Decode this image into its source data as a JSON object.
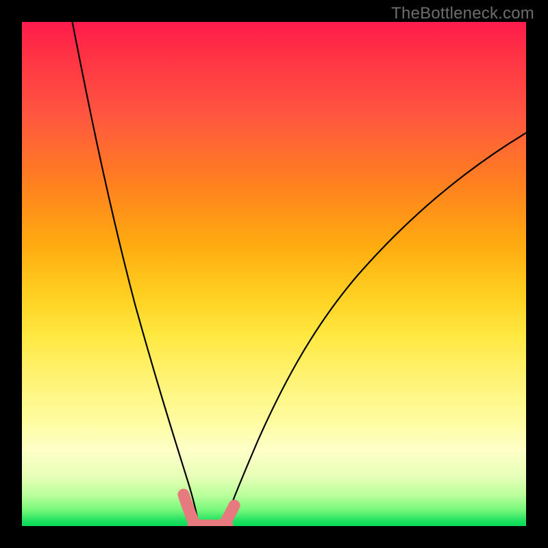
{
  "attribution": "TheBottleneck.com",
  "chart_data": {
    "type": "line",
    "title": "",
    "xlabel": "",
    "ylabel": "",
    "xlim": [
      0,
      100
    ],
    "ylim": [
      0,
      100
    ],
    "legend": false,
    "grid": false,
    "series": [
      {
        "name": "left-branch",
        "x": [
          10,
          14,
          18,
          22,
          25,
          28,
          30,
          32,
          33.5,
          35
        ],
        "y": [
          100,
          80,
          60,
          42,
          29,
          18,
          11,
          6,
          2.5,
          0
        ]
      },
      {
        "name": "floor",
        "x": [
          35,
          40
        ],
        "y": [
          0,
          0
        ]
      },
      {
        "name": "right-branch",
        "x": [
          40,
          42,
          45,
          50,
          57,
          65,
          74,
          84,
          95,
          100
        ],
        "y": [
          0,
          3,
          9,
          19,
          32,
          45,
          56,
          66,
          74,
          78
        ]
      },
      {
        "name": "highlight-left",
        "x": [
          32,
          33,
          34,
          35
        ],
        "y": [
          6,
          3,
          1,
          0
        ]
      },
      {
        "name": "highlight-floor",
        "x": [
          34,
          40
        ],
        "y": [
          0,
          0
        ]
      },
      {
        "name": "highlight-right",
        "x": [
          39,
          40,
          41,
          42
        ],
        "y": [
          0,
          0.5,
          2,
          3.5
        ]
      }
    ],
    "colors": {
      "curve": "#000000",
      "highlight": "#e77a7e",
      "background_gradient": [
        "#ff1a4d",
        "#ffaa10",
        "#fff270",
        "#1ee060"
      ]
    }
  }
}
